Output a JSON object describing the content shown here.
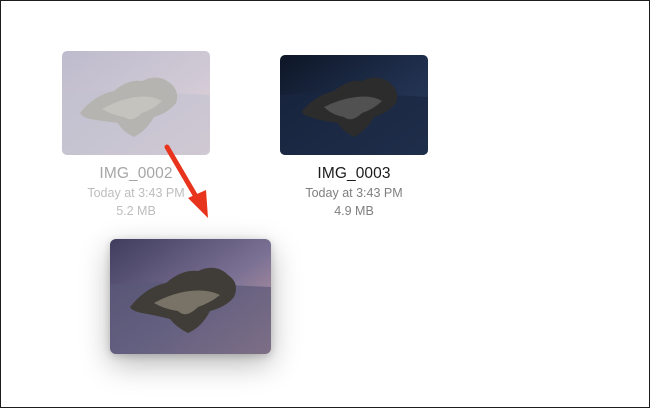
{
  "files": [
    {
      "name": "IMG_0002",
      "date": "Today at 3:43 PM",
      "size": "5.2 MB",
      "state": "dragging-source",
      "thumb_colors": [
        "#c9c4d6",
        "#b8aec9"
      ]
    },
    {
      "name": "IMG_0003",
      "date": "Today at 3:43 PM",
      "size": "4.9 MB",
      "state": "normal",
      "thumb_colors": [
        "#1d2a45",
        "#0f1a2e"
      ]
    }
  ],
  "drag_preview": {
    "icon": "image-thumbnail",
    "colors": [
      "#6a6887",
      "#c9a6ad"
    ]
  },
  "annotation": {
    "icon": "arrow-down-right-icon",
    "color": "#e8341c"
  }
}
